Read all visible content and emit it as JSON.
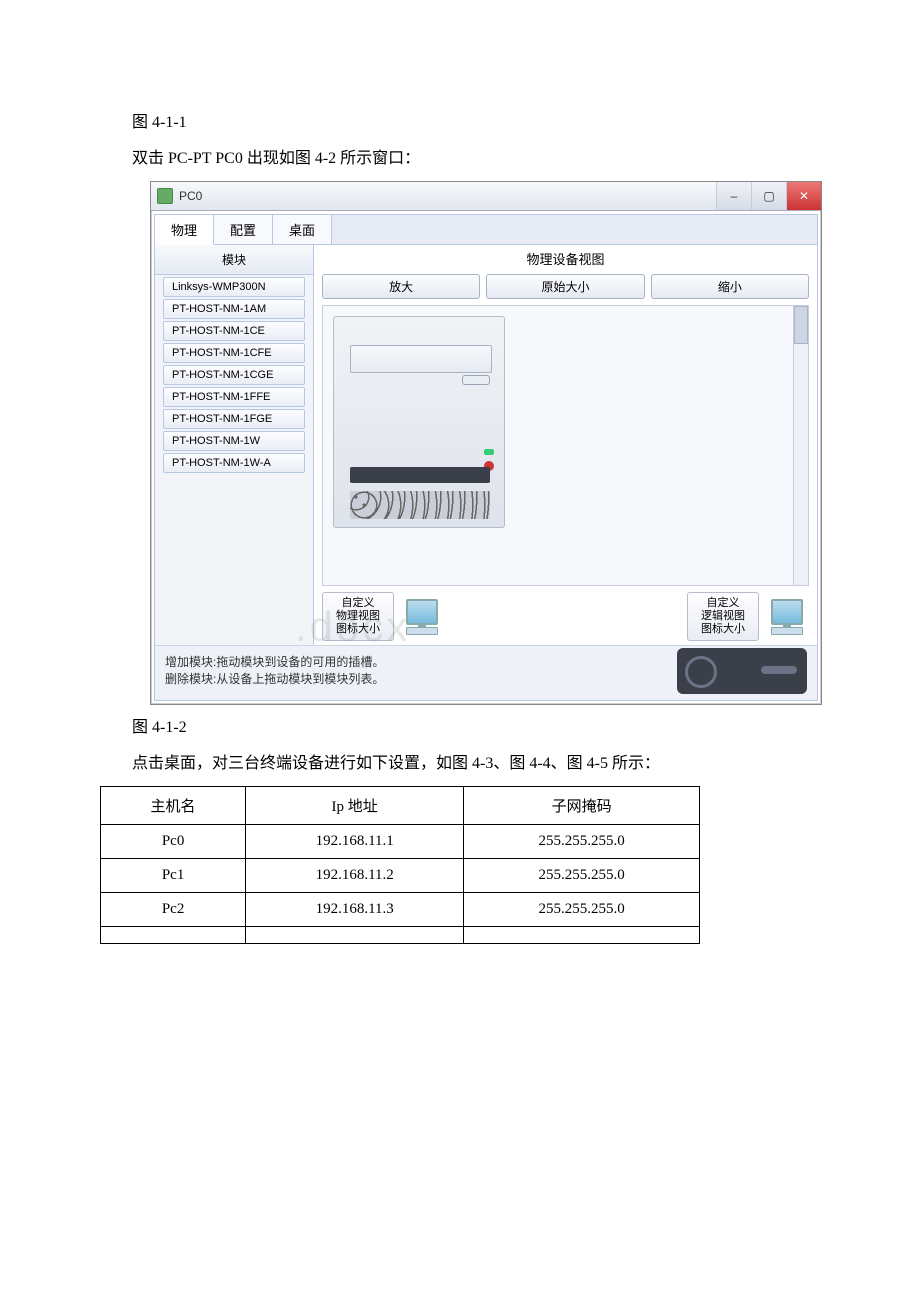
{
  "captions": {
    "fig_4_1_1": "图 4-1-1",
    "intro_line": "双击 PC-PT PC0 出现如图 4-2 所示窗口：",
    "fig_4_1_2": "图 4-1-2",
    "desc_line": "点击桌面，对三台终端设备进行如下设置，如图 4-3、图 4-4、图 4-5 所示：",
    "watermark": ".docx"
  },
  "window": {
    "title": "PC0",
    "tabs": {
      "physical": "物理",
      "config": "配置",
      "desktop": "桌面"
    },
    "modules_header": "模块",
    "modules": [
      "Linksys-WMP300N",
      "PT-HOST-NM-1AM",
      "PT-HOST-NM-1CE",
      "PT-HOST-NM-1CFE",
      "PT-HOST-NM-1CGE",
      "PT-HOST-NM-1FFE",
      "PT-HOST-NM-1FGE",
      "PT-HOST-NM-1W",
      "PT-HOST-NM-1W-A"
    ],
    "right_title": "物理设备视图",
    "zoom": {
      "in": "放大",
      "orig": "原始大小",
      "out": "缩小"
    },
    "custom_physical": "自定义\n物理视图\n图标大小",
    "custom_logical": "自定义\n逻辑视图\n图标大小",
    "hint_add": "增加模块:拖动模块到设备的可用的插槽。",
    "hint_del": "删除模块:从设备上拖动模块到模块列表。",
    "win_min": "–",
    "win_max": "▢",
    "win_close": "✕"
  },
  "table": {
    "headers": {
      "host": "主机名",
      "ip": "Ip 地址",
      "mask": "子网掩码"
    },
    "rows": [
      {
        "host": "Pc0",
        "ip": "192.168.11.1",
        "mask": "255.255.255.0"
      },
      {
        "host": "Pc1",
        "ip": "192.168.11.2",
        "mask": "255.255.255.0"
      },
      {
        "host": "Pc2",
        "ip": "192.168.11.3",
        "mask": "255.255.255.0"
      },
      {
        "host": "",
        "ip": "",
        "mask": ""
      }
    ]
  }
}
